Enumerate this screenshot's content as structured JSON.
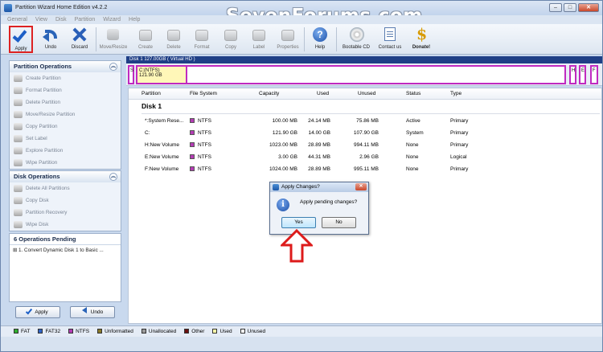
{
  "window": {
    "title": "Partition Wizard Home Edition v4.2.2",
    "watermark": "SevenForums.com"
  },
  "menu": [
    "General",
    "View",
    "Disk",
    "Partition",
    "Wizard",
    "Help"
  ],
  "toolbar": {
    "apply": "Apply",
    "undo": "Undo",
    "discard": "Discard",
    "move_resize": "Move/Resize",
    "create": "Create",
    "delete": "Delete",
    "format": "Format",
    "copy": "Copy",
    "label": "Label",
    "properties": "Properties",
    "help": "Help",
    "bootable_cd": "Bootable CD",
    "contact_us": "Contact us",
    "donate": "Donate!"
  },
  "disk_map": {
    "header": "Disk 1 127.00GB  ( Virtual HD )",
    "first": "S",
    "main_name": "C:(NTFS)",
    "main_size": "121.90 GB",
    "small": [
      "H",
      "E",
      "F"
    ]
  },
  "partition_ops": {
    "title": "Partition Operations",
    "items": [
      "Create Partition",
      "Format Partition",
      "Delete Partition",
      "Move/Resize Partition",
      "Copy Partition",
      "Set Label",
      "Explore Partition",
      "Wipe Partition"
    ]
  },
  "disk_ops": {
    "title": "Disk Operations",
    "items": [
      "Delete All Partitions",
      "Copy Disk",
      "Partition Recovery",
      "Wipe Disk"
    ]
  },
  "pending": {
    "title": "6 Operations Pending",
    "item": "1. Convert Dynamic Disk 1 to Basic ..."
  },
  "bottom_buttons": {
    "apply": "Apply",
    "undo": "Undo"
  },
  "table": {
    "headers": [
      "Partition",
      "File System",
      "Capacity",
      "Used",
      "Unused",
      "Status",
      "Type"
    ],
    "disk_title": "Disk 1",
    "rows": [
      [
        "*:System Rese...",
        "NTFS",
        "100.00 MB",
        "24.14 MB",
        "75.86 MB",
        "Active",
        "Primary"
      ],
      [
        "C:",
        "NTFS",
        "121.90 GB",
        "14.00 GB",
        "107.90 GB",
        "System",
        "Primary"
      ],
      [
        "H:New Volume",
        "NTFS",
        "1023.00 MB",
        "28.89 MB",
        "994.11 MB",
        "None",
        "Primary"
      ],
      [
        "E:New Volume",
        "NTFS",
        "3.00 GB",
        "44.31 MB",
        "2.96 GB",
        "None",
        "Logical"
      ],
      [
        "F:New Volume",
        "NTFS",
        "1024.00 MB",
        "28.89 MB",
        "995.11 MB",
        "None",
        "Primary"
      ]
    ]
  },
  "dialog": {
    "title": "Apply Changes?",
    "message": "Apply pending changes?",
    "yes": "Yes",
    "no": "No"
  },
  "legend": [
    {
      "label": "FAT",
      "color": "#2fae2f"
    },
    {
      "label": "FAT32",
      "color": "#2f63c6"
    },
    {
      "label": "NTFS",
      "color": "#b43cb4"
    },
    {
      "label": "Unformatted",
      "color": "#8a7a2a"
    },
    {
      "label": "Unallocated",
      "color": "#9a9a9a"
    },
    {
      "label": "Other",
      "color": "#6a1010"
    },
    {
      "label": "Used",
      "color": "#ffffa8"
    },
    {
      "label": "Unused",
      "color": "#ffffff"
    }
  ],
  "colors": {
    "ntfs": "#b43cb4",
    "highlight": "#d22222",
    "accent": "#1f3f86"
  }
}
